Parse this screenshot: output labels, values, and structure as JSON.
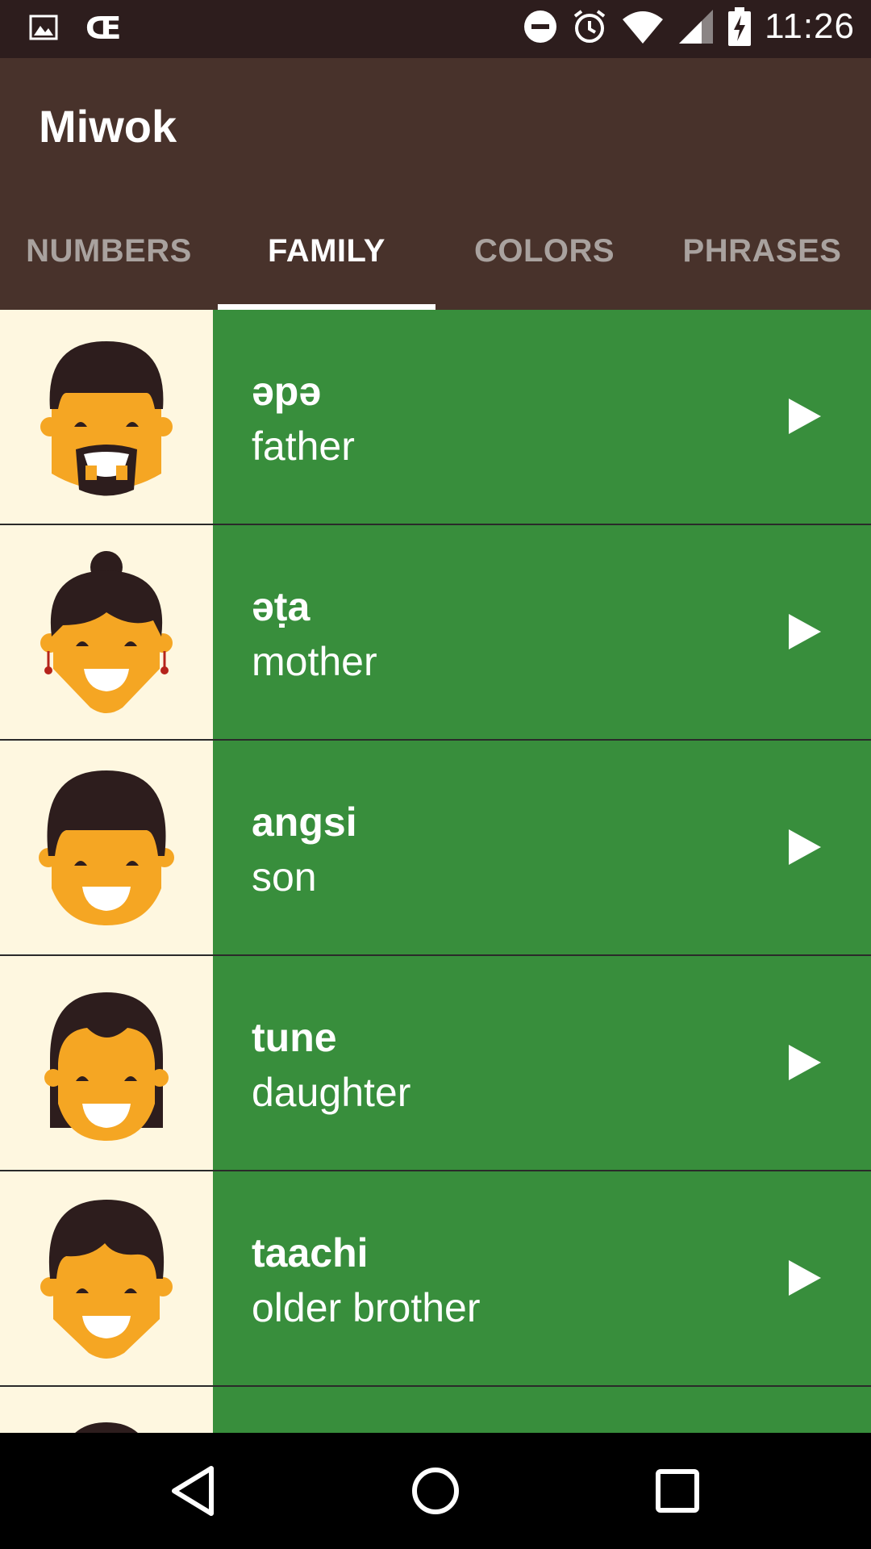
{
  "status_bar": {
    "time": "11:26",
    "icons_left": [
      "image-icon",
      "cc-icon"
    ],
    "icons_right": [
      "do-not-disturb-icon",
      "alarm-icon",
      "wifi-icon",
      "signal-icon",
      "battery-charging-icon"
    ]
  },
  "app_bar": {
    "title": "Miwok",
    "background": "#48322b"
  },
  "tabs": [
    {
      "label": "NUMBERS",
      "active": false
    },
    {
      "label": "FAMILY",
      "active": true
    },
    {
      "label": "COLORS",
      "active": false
    },
    {
      "label": "PHRASES",
      "active": false
    }
  ],
  "list": {
    "item_color": "#388e3c",
    "image_bg": "#fef7e0",
    "items": [
      {
        "miwok": "əpə",
        "default": "father",
        "icon": "father-icon"
      },
      {
        "miwok": "əṭa",
        "default": "mother",
        "icon": "mother-icon"
      },
      {
        "miwok": "angsi",
        "default": "son",
        "icon": "son-icon"
      },
      {
        "miwok": "tune",
        "default": "daughter",
        "icon": "daughter-icon"
      },
      {
        "miwok": "taachi",
        "default": "older brother",
        "icon": "older-brother-icon"
      }
    ]
  },
  "nav_bar": {
    "buttons": [
      "back-icon",
      "home-icon",
      "recents-icon"
    ]
  }
}
